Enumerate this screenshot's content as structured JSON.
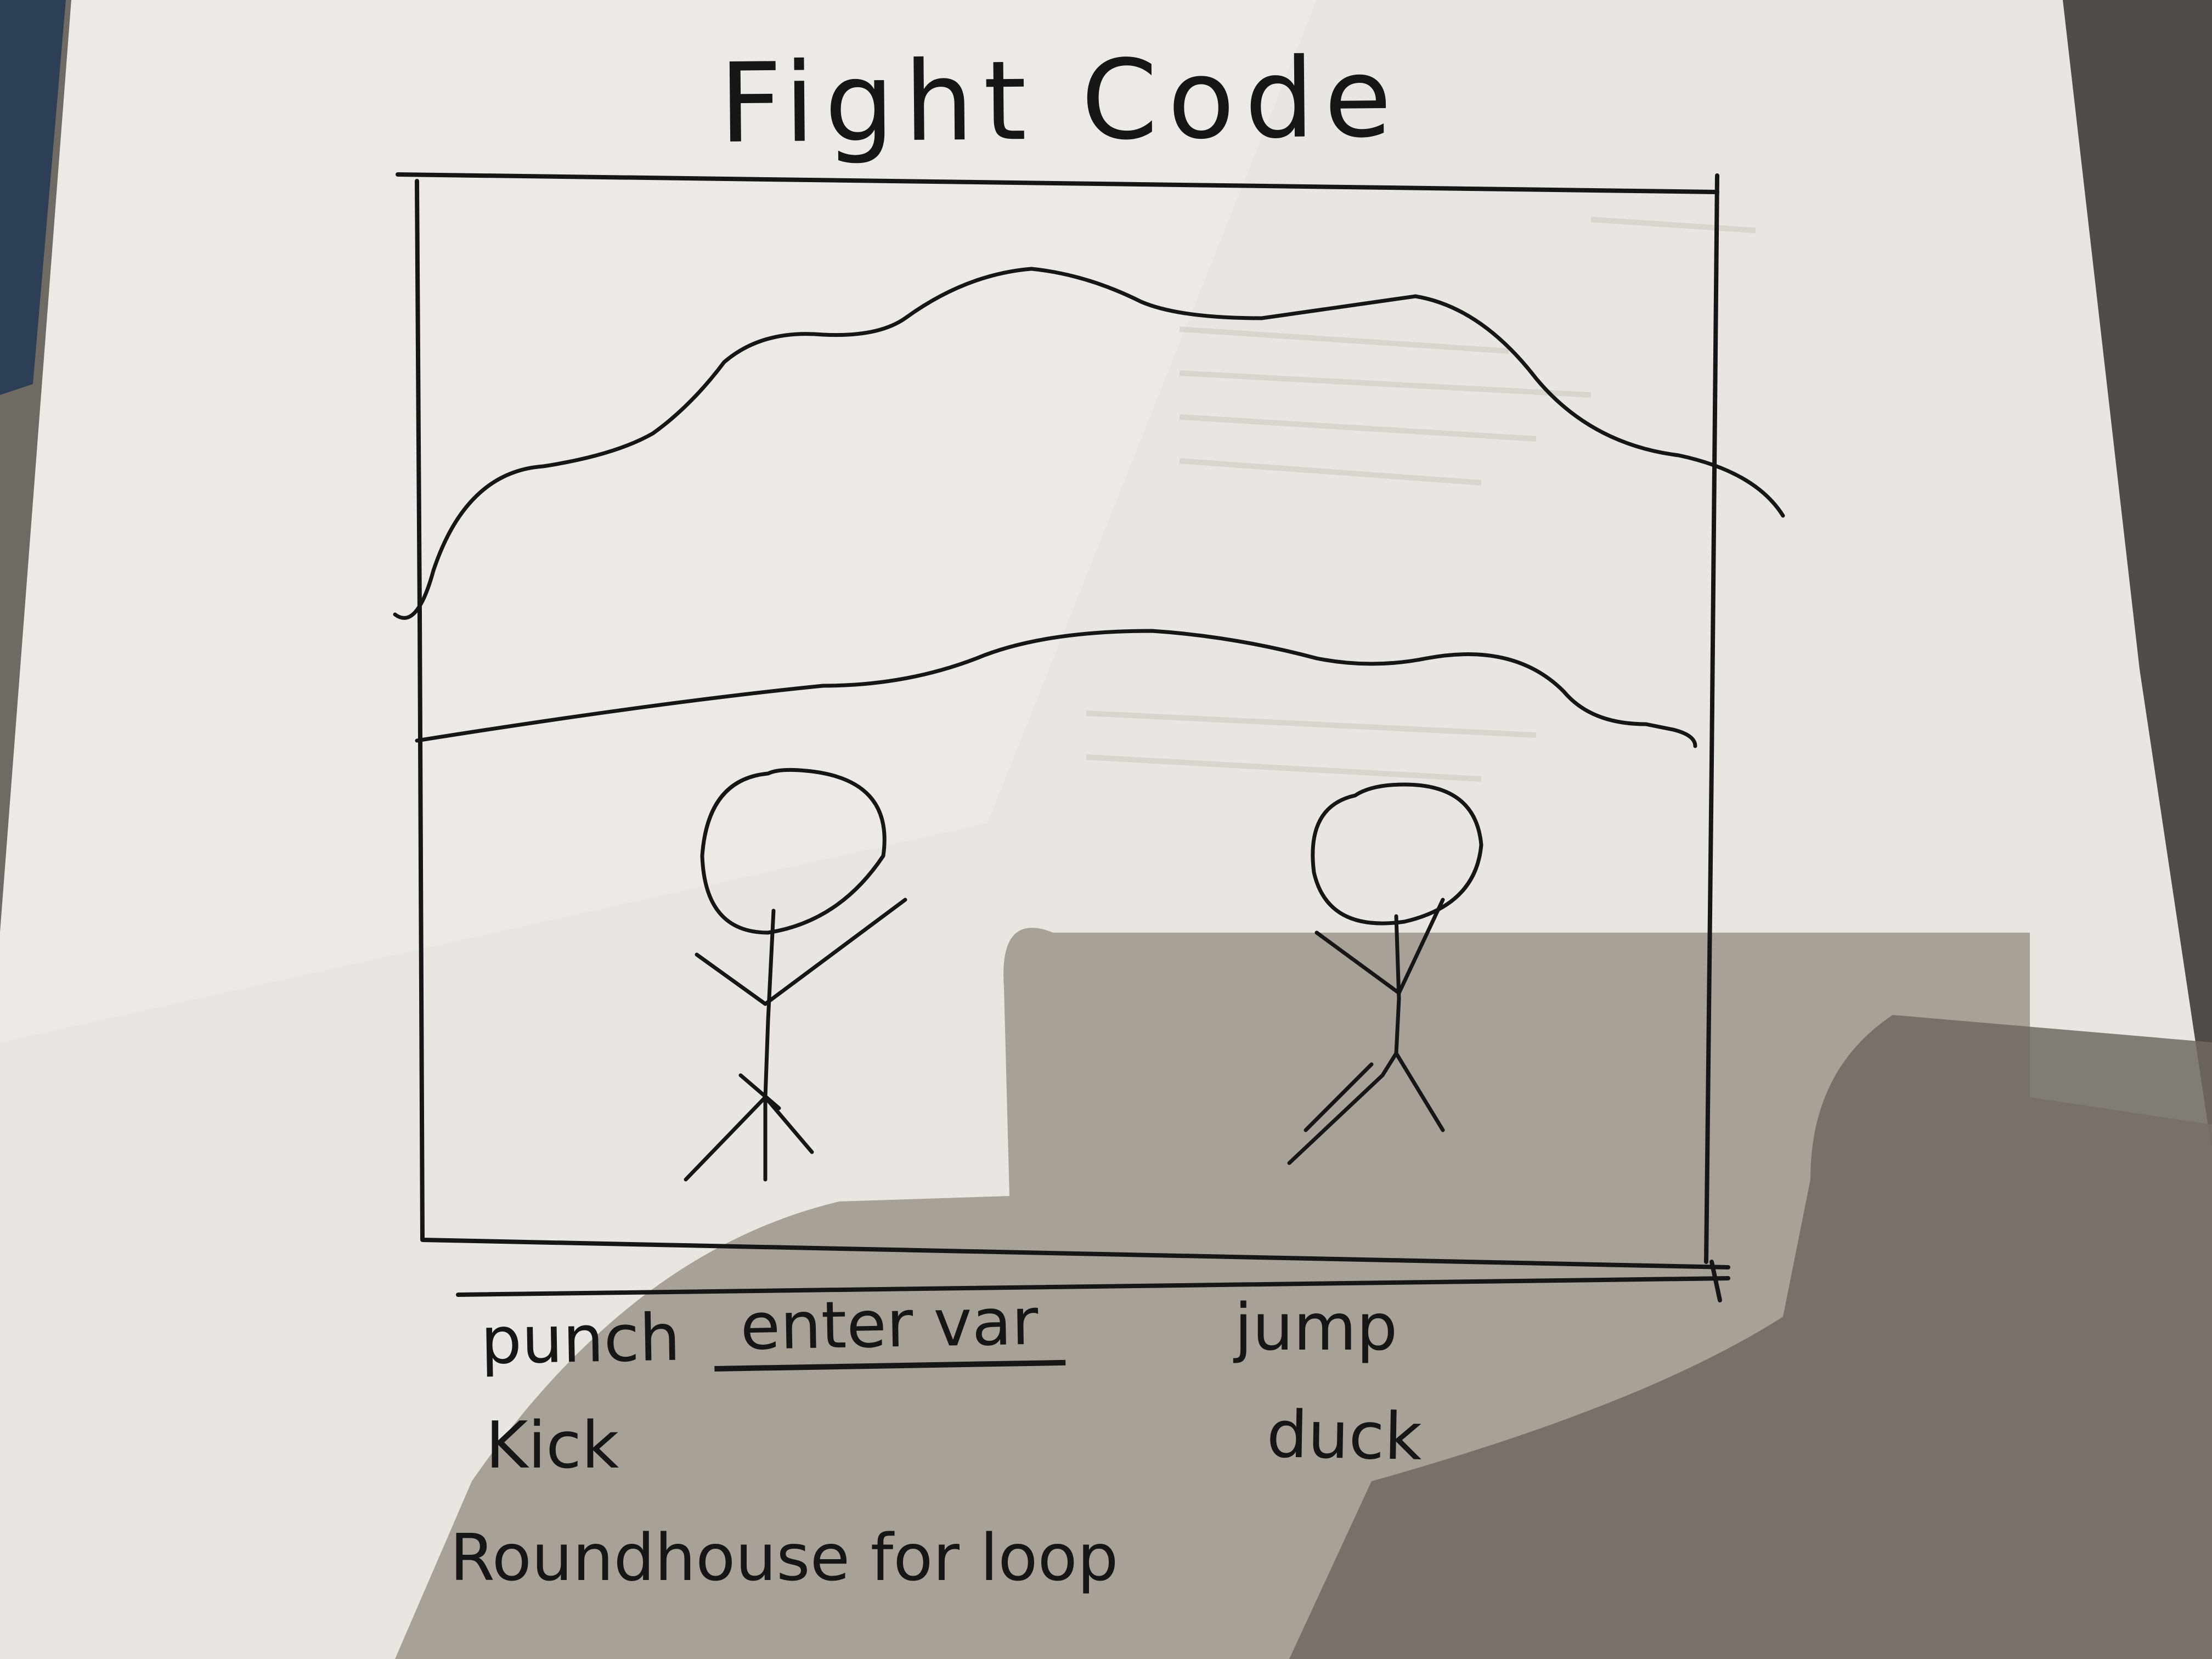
{
  "sketch": {
    "title": "Fight Code",
    "commands": {
      "punch": "punch",
      "kick": "Kick",
      "roundhouse": "Roundhouse for loop",
      "jump": "jump",
      "duck": "duck"
    },
    "input_placeholder": "enter var"
  },
  "colors": {
    "paper": "#e7e3de",
    "ink": "#161616",
    "background": "#6f6a64",
    "shadow": "#9a938b"
  }
}
